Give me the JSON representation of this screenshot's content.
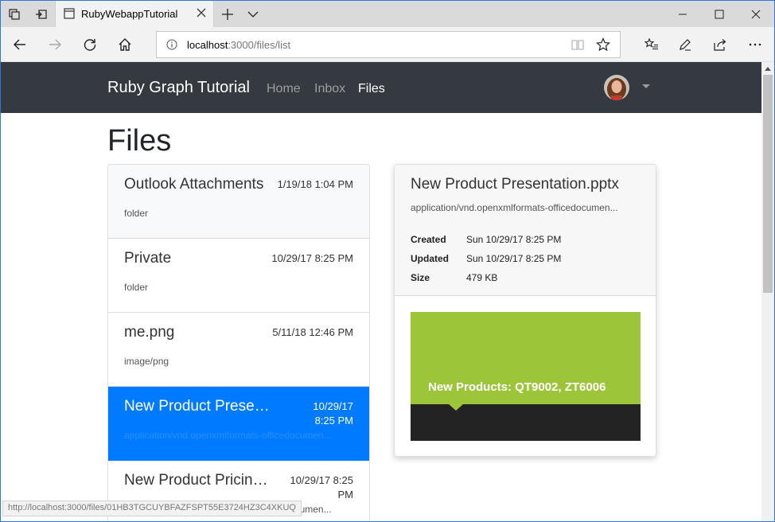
{
  "browser": {
    "tab_title": "RubyWebappTutorial",
    "url_host": "localhost",
    "url_path": ":3000/files/list",
    "status_url": "http://localhost:3000/files/01HB3TGCUYBFAZFSPT55E3724HZ3C4XKUQ"
  },
  "site": {
    "brand": "Ruby Graph Tutorial",
    "nav": [
      "Home",
      "Inbox",
      "Files"
    ],
    "active_nav": "Files"
  },
  "page": {
    "title": "Files"
  },
  "files": [
    {
      "name": "Outlook Attachments",
      "date": "1/19/18 1:04 PM",
      "type": "folder"
    },
    {
      "name": "Private",
      "date": "10/29/17 8:25 PM",
      "type": "folder"
    },
    {
      "name": "me.png",
      "date": "5/11/18 12:46 PM",
      "type": "image/png"
    },
    {
      "name": "New Product Presenta...",
      "date": "10/29/17 8:25 PM",
      "type": "application/vnd.openxmlformats-officedocumen..."
    },
    {
      "name": "New Product Pricing....",
      "date": "10/29/17 8:25 PM",
      "type": "application/vnd.openxmlformats-officedocumen..."
    }
  ],
  "detail": {
    "name": "New Product Presentation.pptx",
    "mime": "application/vnd.openxmlformats-officedocumen...",
    "created_label": "Created",
    "created": "Sun 10/29/17 8:25 PM",
    "updated_label": "Updated",
    "updated": "Sun 10/29/17 8:25 PM",
    "size_label": "Size",
    "size": "479 KB",
    "preview_title": "New Products: QT9002, ZT6006"
  },
  "colors": {
    "navbar": "#343a40",
    "selected": "#007bff",
    "preview_green": "#9dc53a"
  }
}
